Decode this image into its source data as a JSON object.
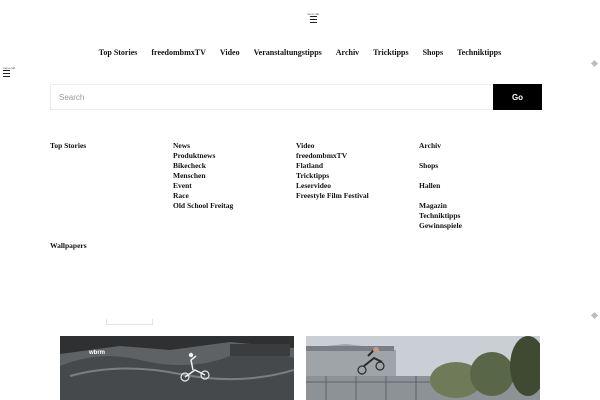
{
  "header": {
    "top_menu_label": "menu lab",
    "side_menu_label": "menu lab"
  },
  "nav": [
    "Top Stories",
    "freedombmxTV",
    "Video",
    "Veranstaltungstipps",
    "Archiv",
    "Tricktipps",
    "Shops",
    "Techniktipps"
  ],
  "search": {
    "placeholder": "Search",
    "value": "",
    "button_label": "Go"
  },
  "menu": {
    "col1": {
      "heading": "Top Stories"
    },
    "col2": {
      "heading": "News",
      "items": [
        "Produktnews",
        "Bikecheck",
        "Menschen",
        "Event",
        "Race",
        "Old School Freitag"
      ]
    },
    "col3": {
      "heading": "Video",
      "items": [
        "freedombmxTV",
        "Flatland",
        "Tricktipps",
        "Leservideo",
        "Freestyle Film Festival"
      ]
    },
    "col4": {
      "items": [
        "Archiv",
        "Shops",
        "Hallen",
        "Magazin",
        "Techniktipps",
        "Gewinnspiele"
      ]
    },
    "wallpapers": "Wallpapers"
  },
  "thumbs": {
    "left_logo": "wbrm"
  },
  "colors": {
    "accent": "#000000",
    "text": "#111111",
    "border": "#ececec"
  }
}
